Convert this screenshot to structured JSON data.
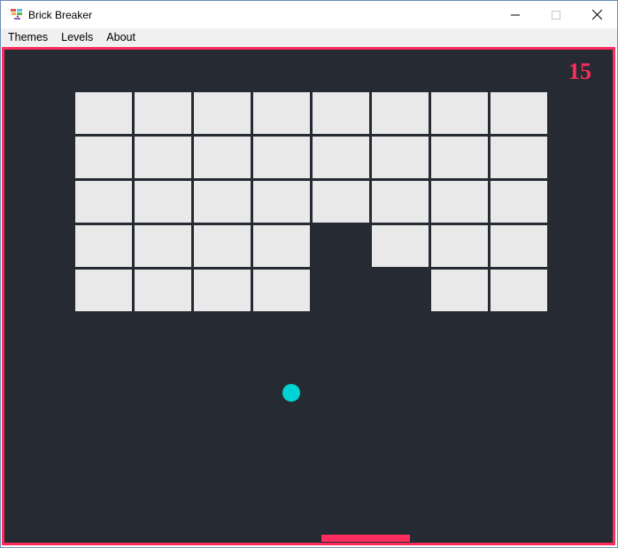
{
  "window": {
    "title": "Brick Breaker",
    "icons": {
      "app": "brick-breaker-app-icon",
      "minimize": "minimize-icon",
      "maximize": "maximize-icon",
      "close": "close-icon"
    }
  },
  "menu": {
    "items": [
      {
        "label": "Themes"
      },
      {
        "label": "Levels"
      },
      {
        "label": "About"
      }
    ]
  },
  "game": {
    "score": "15",
    "colors": {
      "background": "#262a33",
      "border": "#ff2d5e",
      "score": "#ff2d5e",
      "brick": "#e9e9e9",
      "ball": "#00d3d3",
      "paddle": "#ff2d5e"
    },
    "bricks": {
      "rows": 5,
      "cols": 8,
      "present": [
        [
          1,
          1,
          1,
          1,
          1,
          1,
          1,
          1
        ],
        [
          1,
          1,
          1,
          1,
          1,
          1,
          1,
          1
        ],
        [
          1,
          1,
          1,
          1,
          1,
          1,
          1,
          1
        ],
        [
          1,
          1,
          1,
          1,
          0,
          1,
          1,
          1
        ],
        [
          1,
          1,
          1,
          1,
          0,
          0,
          1,
          1
        ]
      ]
    }
  }
}
